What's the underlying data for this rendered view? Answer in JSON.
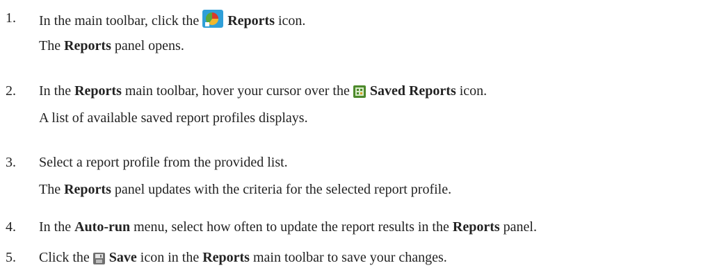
{
  "steps": [
    {
      "number": "1.",
      "pre": "In the main toolbar, click the",
      "icon": "reports-icon",
      "bold": "Reports",
      "post": "icon.",
      "result_bold": "Reports",
      "result_pre": "The",
      "result_post": "panel opens."
    },
    {
      "number": "2.",
      "pre": "In the",
      "bold1": "Reports",
      "mid": "main toolbar, hover your cursor over the",
      "icon": "saved-reports-icon",
      "bold2": "Saved Reports",
      "post": "icon.",
      "result": "A list of available saved report profiles displays."
    },
    {
      "number": "3.",
      "text": "Select a report profile from the provided list.",
      "result_pre": "The",
      "result_bold": "Reports",
      "result_post": "panel updates with the criteria for the selected report profile."
    },
    {
      "number": "4.",
      "pre": "In the",
      "bold1": "Auto-run",
      "mid": "menu, select how often to update the report results in the",
      "bold2": "Reports",
      "post": "panel."
    },
    {
      "number": "5.",
      "pre": "Click the",
      "icon": "save-icon",
      "bold1": "Save",
      "mid": "icon in the",
      "bold2": "Reports",
      "post": "main toolbar to save your changes."
    }
  ],
  "colors": {
    "text": "#222222",
    "reports_icon_bg": "#2f9fd8",
    "saved_reports_icon": "#4d8a2c",
    "save_icon": "#6f6f6f"
  }
}
